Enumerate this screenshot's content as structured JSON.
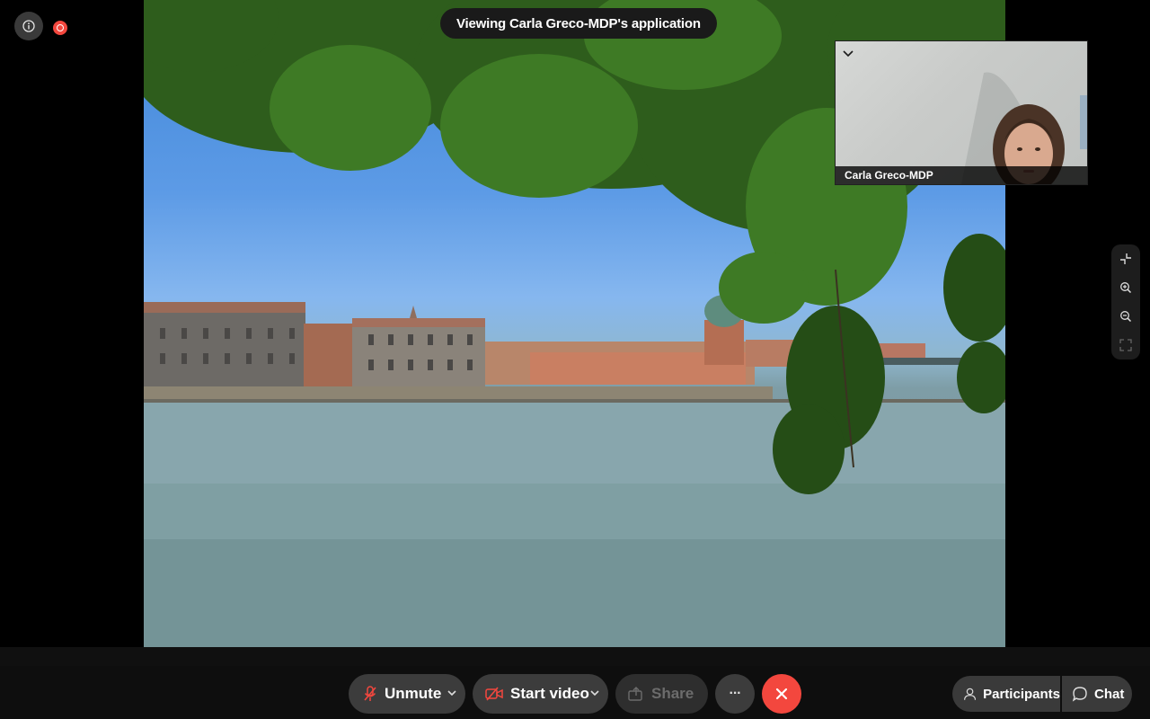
{
  "banner": {
    "text": "Viewing Carla Greco-MDP's application"
  },
  "video_tile": {
    "participant_name": "Carla Greco-MDP"
  },
  "controls": {
    "unmute_label": "Unmute",
    "start_video_label": "Start video",
    "share_label": "Share",
    "more_label": "···",
    "participants_label": "Participants",
    "chat_label": "Chat"
  },
  "colors": {
    "end_call": "#f3473e",
    "recording": "#f3473e",
    "mic_muted": "#f3473e",
    "button_bg": "#3c3c3c"
  },
  "icons": [
    "info-icon",
    "recording-icon",
    "collapse-icon",
    "exit-fullscreen-icon",
    "zoom-in-icon",
    "zoom-out-icon",
    "fullscreen-icon",
    "mic-off-icon",
    "video-off-icon",
    "share-icon",
    "more-icon",
    "end-call-icon",
    "participants-icon",
    "chat-icon"
  ]
}
